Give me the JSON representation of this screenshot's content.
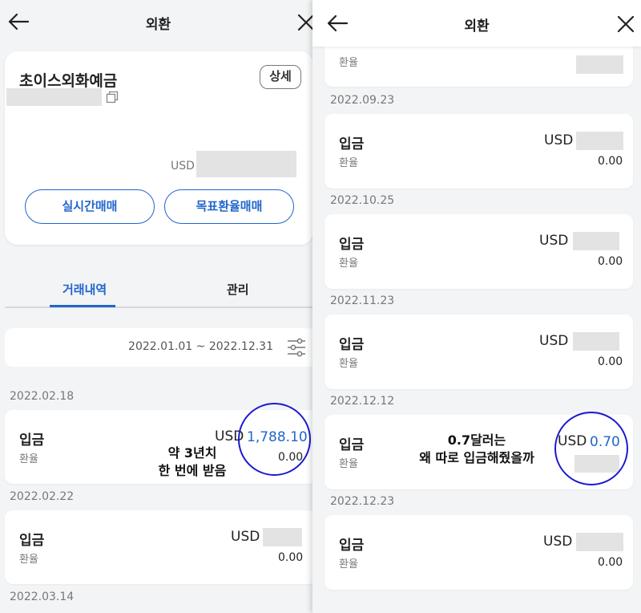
{
  "left": {
    "title": "외환",
    "account": {
      "name": "초이스외화예금",
      "detail_label": "상세",
      "balance_currency": "USD"
    },
    "buttons": {
      "realtime": "실시간매매",
      "target": "목표환율매매"
    },
    "tabs": {
      "history": "거래내역",
      "manage": "관리"
    },
    "date_range": "2022.01.01 ~ 2022.12.31",
    "transactions": [
      {
        "date": "2022.02.18",
        "type": "입금",
        "rate_label": "환율",
        "currency": "USD",
        "amount": "1,788.10",
        "rate": "0.00"
      },
      {
        "date": "2022.02.22",
        "type": "입금",
        "rate_label": "환율",
        "currency": "USD",
        "rate": "0.00"
      }
    ],
    "next_date": "2022.03.14",
    "annotation": "약 3년치\n한 번에 받음"
  },
  "right": {
    "title": "외환",
    "partial_rate_label": "환율",
    "transactions": [
      {
        "date": "2022.09.23",
        "type": "입금",
        "rate_label": "환율",
        "currency": "USD",
        "rate": "0.00"
      },
      {
        "date": "2022.10.25",
        "type": "입금",
        "rate_label": "환율",
        "currency": "USD",
        "rate": "0.00"
      },
      {
        "date": "2022.11.23",
        "type": "입금",
        "rate_label": "환율",
        "currency": "USD",
        "rate": "0.00"
      },
      {
        "date": "2022.12.12",
        "type": "입금",
        "rate_label": "환율",
        "currency": "USD",
        "amount": "0.70"
      },
      {
        "date": "2022.12.23",
        "type": "입금",
        "rate_label": "환율",
        "currency": "USD",
        "rate": "0.00"
      }
    ],
    "annotation": "0.7달러는\n왜 따로 입금해줬을까"
  },
  "colors": {
    "accent": "#2266cc",
    "annotation_circle": "#1a1ad0",
    "background": "#f3f4f6",
    "redaction": "#e3e3e3"
  }
}
